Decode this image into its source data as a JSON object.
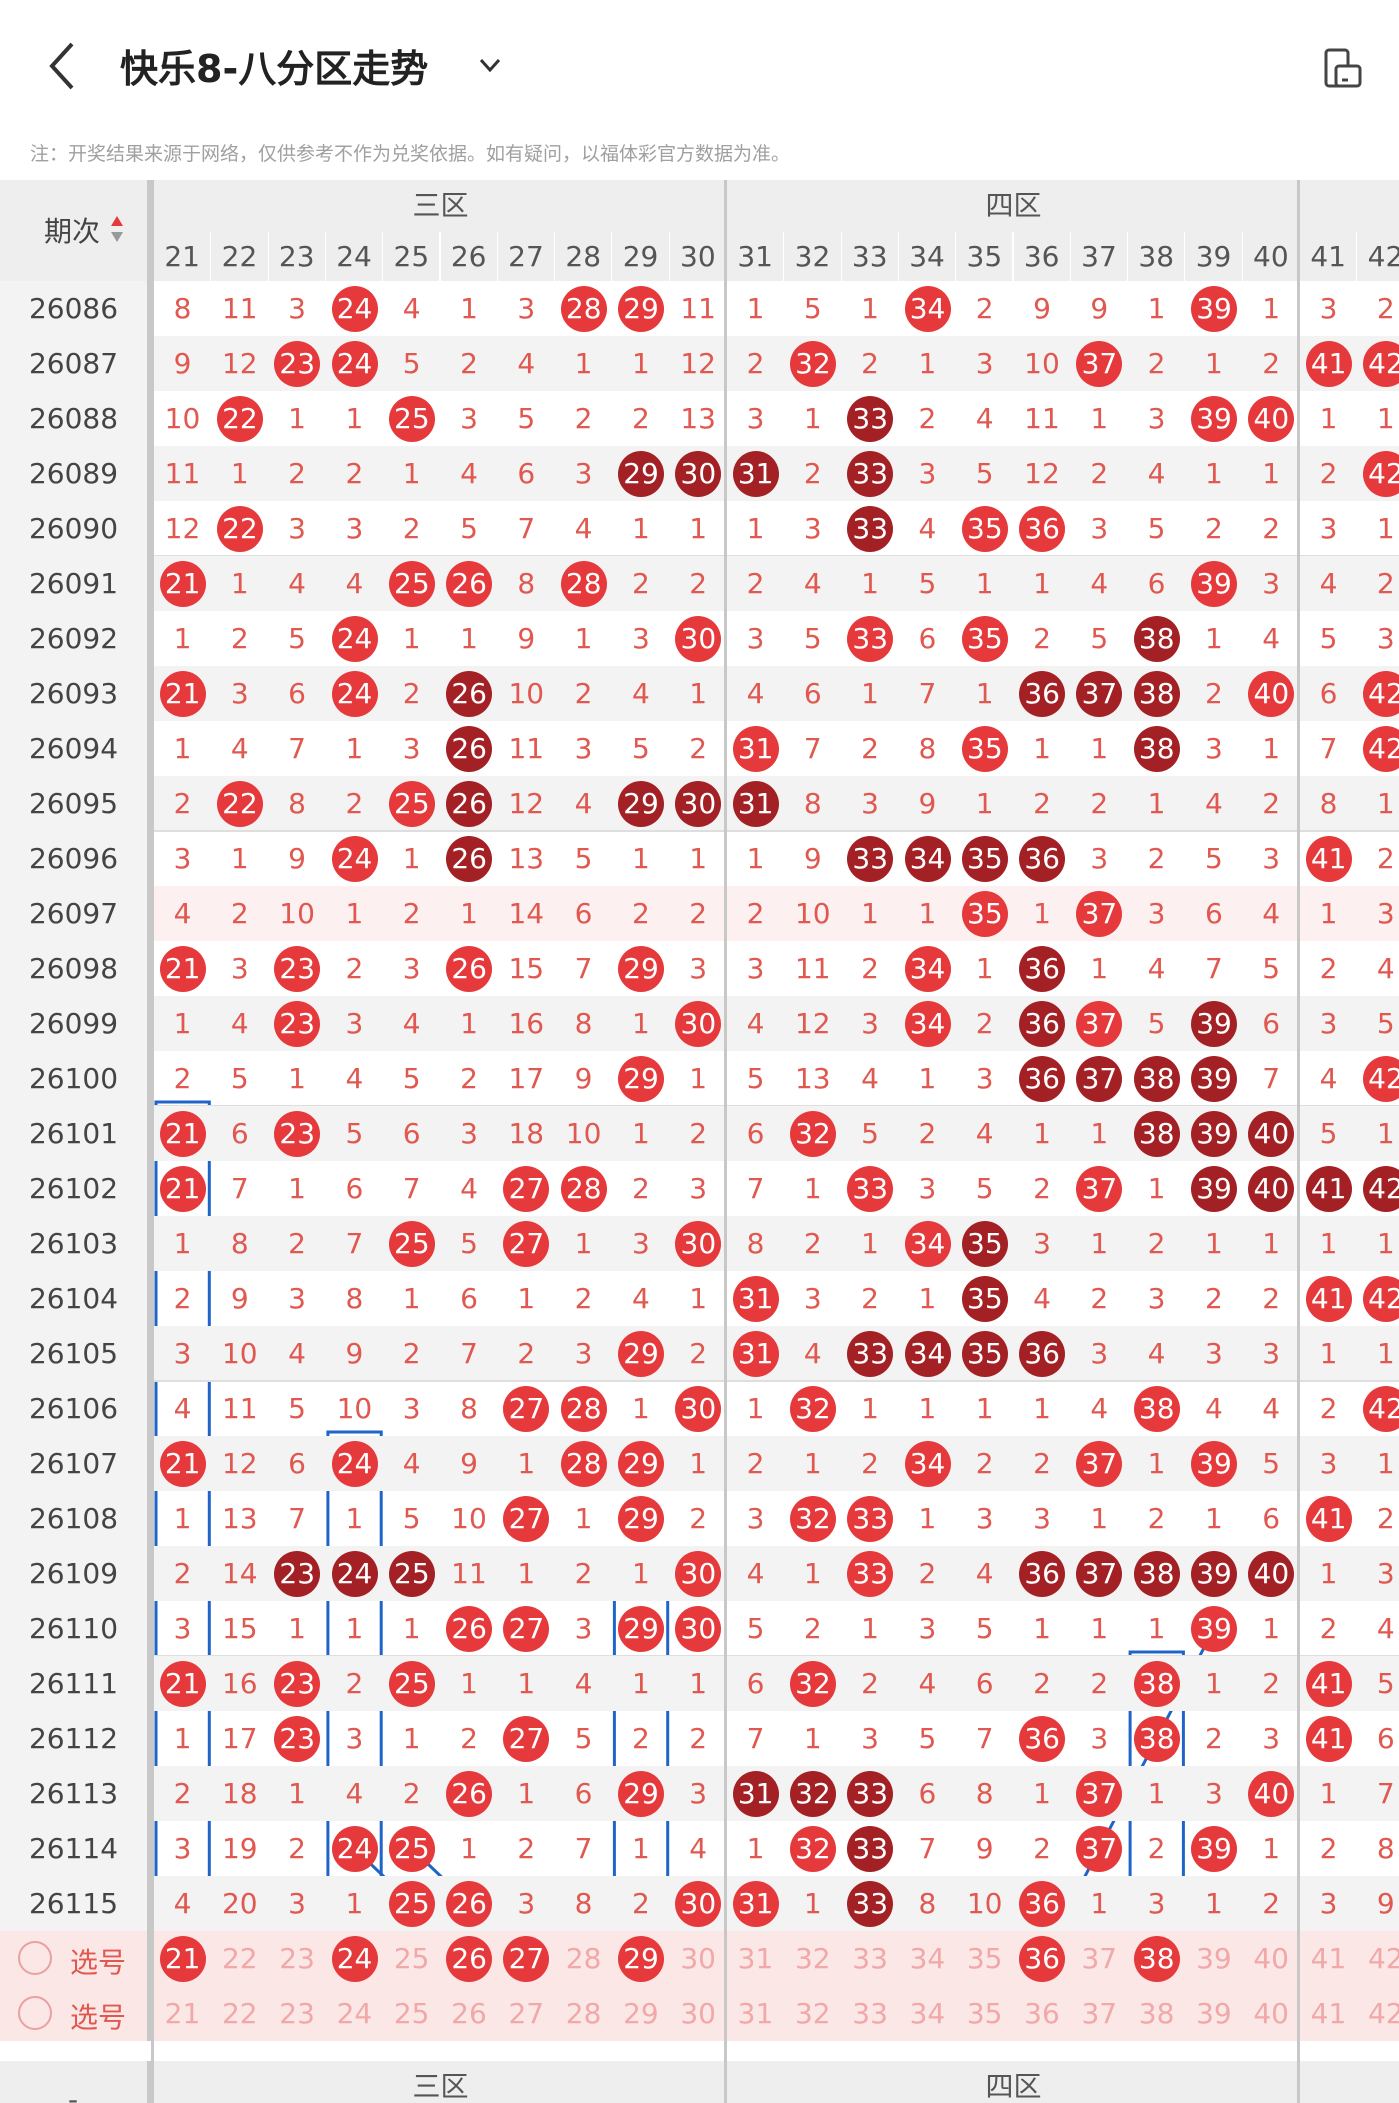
{
  "header": {
    "title": "快乐8-八分区走势"
  },
  "notice": "注：开奖结果来源于网络，仅供参考不作为兑奖依据。如有疑问，以福体彩官方数据为准。",
  "table": {
    "period_header": "期次",
    "zones": [
      {
        "name": "三区",
        "cols": [
          21,
          22,
          23,
          24,
          25,
          26,
          27,
          28,
          29,
          30
        ]
      },
      {
        "name": "四区",
        "cols": [
          31,
          32,
          33,
          34,
          35,
          36,
          37,
          38,
          39,
          40
        ]
      },
      {
        "name": "",
        "cols": [
          41,
          42
        ]
      }
    ],
    "rows": [
      {
        "period": "26086",
        "cells": [
          "8",
          "11",
          "3",
          "24",
          "4",
          "1",
          "3",
          "28",
          "29",
          "11",
          "1",
          "5",
          "1",
          "34",
          "2",
          "9",
          "9",
          "1",
          "39",
          "1",
          "3",
          "2"
        ],
        "dark": []
      },
      {
        "period": "26087",
        "cells": [
          "9",
          "12",
          "23",
          "24",
          "5",
          "2",
          "4",
          "1",
          "1",
          "12",
          "2",
          "32",
          "2",
          "1",
          "3",
          "10",
          "37",
          "2",
          "1",
          "2",
          "41",
          "42"
        ],
        "dark": []
      },
      {
        "period": "26088",
        "cells": [
          "10",
          "22",
          "1",
          "1",
          "25",
          "3",
          "5",
          "2",
          "2",
          "13",
          "3",
          "1",
          "33",
          "2",
          "4",
          "11",
          "1",
          "3",
          "39",
          "40",
          "1",
          "1"
        ],
        "dark": [
          "33"
        ]
      },
      {
        "period": "26089",
        "cells": [
          "11",
          "1",
          "2",
          "2",
          "1",
          "4",
          "6",
          "3",
          "29",
          "30",
          "31",
          "2",
          "33",
          "3",
          "5",
          "12",
          "2",
          "4",
          "1",
          "1",
          "2",
          "42"
        ],
        "dark": [
          "29",
          "30",
          "31",
          "33"
        ]
      },
      {
        "period": "26090",
        "cells": [
          "12",
          "22",
          "3",
          "3",
          "2",
          "5",
          "7",
          "4",
          "1",
          "1",
          "1",
          "3",
          "33",
          "4",
          "35",
          "36",
          "3",
          "5",
          "2",
          "2",
          "3",
          "1"
        ],
        "dark": [
          "33"
        ]
      },
      {
        "period": "26091",
        "cells": [
          "21",
          "1",
          "4",
          "4",
          "25",
          "26",
          "8",
          "28",
          "2",
          "2",
          "2",
          "4",
          "1",
          "5",
          "1",
          "1",
          "4",
          "6",
          "39",
          "3",
          "4",
          "2"
        ],
        "dark": []
      },
      {
        "period": "26092",
        "cells": [
          "1",
          "2",
          "5",
          "24",
          "1",
          "1",
          "9",
          "1",
          "3",
          "30",
          "3",
          "5",
          "33",
          "6",
          "35",
          "2",
          "5",
          "38",
          "1",
          "4",
          "5",
          "3"
        ],
        "dark": [
          "38"
        ]
      },
      {
        "period": "26093",
        "cells": [
          "21",
          "3",
          "6",
          "24",
          "2",
          "26",
          "10",
          "2",
          "4",
          "1",
          "4",
          "6",
          "1",
          "7",
          "1",
          "36",
          "37",
          "38",
          "2",
          "40",
          "6",
          "42"
        ],
        "dark": [
          "26",
          "36",
          "37",
          "38"
        ]
      },
      {
        "period": "26094",
        "cells": [
          "1",
          "4",
          "7",
          "1",
          "3",
          "26",
          "11",
          "3",
          "5",
          "2",
          "31",
          "7",
          "2",
          "8",
          "35",
          "1",
          "1",
          "38",
          "3",
          "1",
          "7",
          "42"
        ],
        "dark": [
          "26",
          "38"
        ]
      },
      {
        "period": "26095",
        "cells": [
          "2",
          "22",
          "8",
          "2",
          "25",
          "26",
          "12",
          "4",
          "29",
          "30",
          "31",
          "8",
          "3",
          "9",
          "1",
          "2",
          "2",
          "1",
          "4",
          "2",
          "8",
          "1"
        ],
        "dark": [
          "26",
          "29",
          "30",
          "31"
        ]
      },
      {
        "period": "26096",
        "cells": [
          "3",
          "1",
          "9",
          "24",
          "1",
          "26",
          "13",
          "5",
          "1",
          "1",
          "1",
          "9",
          "33",
          "34",
          "35",
          "36",
          "3",
          "2",
          "5",
          "3",
          "41",
          "2"
        ],
        "dark": [
          "26",
          "33",
          "34",
          "35",
          "36"
        ]
      },
      {
        "period": "26097",
        "cells": [
          "4",
          "2",
          "10",
          "1",
          "2",
          "1",
          "14",
          "6",
          "2",
          "2",
          "2",
          "10",
          "1",
          "1",
          "35",
          "1",
          "37",
          "3",
          "6",
          "4",
          "1",
          "3"
        ],
        "dark": []
      },
      {
        "period": "26098",
        "cells": [
          "21",
          "3",
          "23",
          "2",
          "3",
          "26",
          "15",
          "7",
          "29",
          "3",
          "3",
          "11",
          "2",
          "34",
          "1",
          "36",
          "1",
          "4",
          "7",
          "5",
          "2",
          "4"
        ],
        "dark": [
          "36"
        ]
      },
      {
        "period": "26099",
        "cells": [
          "1",
          "4",
          "23",
          "3",
          "4",
          "1",
          "16",
          "8",
          "1",
          "30",
          "4",
          "12",
          "3",
          "34",
          "2",
          "36",
          "37",
          "5",
          "39",
          "6",
          "3",
          "5"
        ],
        "dark": [
          "36",
          "39"
        ]
      },
      {
        "period": "26100",
        "cells": [
          "2",
          "5",
          "1",
          "4",
          "5",
          "2",
          "17",
          "9",
          "29",
          "1",
          "5",
          "13",
          "4",
          "1",
          "3",
          "36",
          "37",
          "38",
          "39",
          "7",
          "4",
          "42"
        ],
        "dark": [
          "36",
          "37",
          "38",
          "39"
        ]
      },
      {
        "period": "26101",
        "cells": [
          "21",
          "6",
          "23",
          "5",
          "6",
          "3",
          "18",
          "10",
          "1",
          "2",
          "6",
          "32",
          "5",
          "2",
          "4",
          "1",
          "1",
          "38",
          "39",
          "40",
          "5",
          "1"
        ],
        "dark": [
          "38",
          "39",
          "40"
        ]
      },
      {
        "period": "26102",
        "cells": [
          "21",
          "7",
          "1",
          "6",
          "7",
          "4",
          "27",
          "28",
          "2",
          "3",
          "7",
          "1",
          "33",
          "3",
          "5",
          "2",
          "37",
          "1",
          "39",
          "40",
          "41",
          "42"
        ],
        "dark": [
          "39",
          "40",
          "41",
          "42"
        ]
      },
      {
        "period": "26103",
        "cells": [
          "1",
          "8",
          "2",
          "7",
          "25",
          "5",
          "27",
          "1",
          "3",
          "30",
          "8",
          "2",
          "1",
          "34",
          "35",
          "3",
          "1",
          "2",
          "1",
          "1",
          "1",
          "1"
        ],
        "dark": [
          "35"
        ]
      },
      {
        "period": "26104",
        "cells": [
          "2",
          "9",
          "3",
          "8",
          "1",
          "6",
          "1",
          "2",
          "4",
          "1",
          "31",
          "3",
          "2",
          "1",
          "35",
          "4",
          "2",
          "3",
          "2",
          "2",
          "41",
          "42"
        ],
        "dark": [
          "35"
        ]
      },
      {
        "period": "26105",
        "cells": [
          "3",
          "10",
          "4",
          "9",
          "2",
          "7",
          "2",
          "3",
          "29",
          "2",
          "31",
          "4",
          "33",
          "34",
          "35",
          "36",
          "3",
          "4",
          "3",
          "3",
          "1",
          "1"
        ],
        "dark": [
          "33",
          "34",
          "35",
          "36"
        ]
      },
      {
        "period": "26106",
        "cells": [
          "4",
          "11",
          "5",
          "10",
          "3",
          "8",
          "27",
          "28",
          "1",
          "30",
          "1",
          "32",
          "1",
          "1",
          "1",
          "1",
          "4",
          "38",
          "4",
          "4",
          "2",
          "42"
        ],
        "dark": []
      },
      {
        "period": "26107",
        "cells": [
          "21",
          "12",
          "6",
          "24",
          "4",
          "9",
          "1",
          "28",
          "29",
          "1",
          "2",
          "1",
          "2",
          "34",
          "2",
          "2",
          "37",
          "1",
          "39",
          "5",
          "3",
          "1"
        ],
        "dark": []
      },
      {
        "period": "26108",
        "cells": [
          "1",
          "13",
          "7",
          "1",
          "5",
          "10",
          "27",
          "1",
          "29",
          "2",
          "3",
          "32",
          "33",
          "1",
          "3",
          "3",
          "1",
          "2",
          "1",
          "6",
          "41",
          "2"
        ],
        "dark": []
      },
      {
        "period": "26109",
        "cells": [
          "2",
          "14",
          "23",
          "24",
          "25",
          "11",
          "1",
          "2",
          "1",
          "30",
          "4",
          "1",
          "33",
          "2",
          "4",
          "36",
          "37",
          "38",
          "39",
          "40",
          "1",
          "3"
        ],
        "dark": [
          "23",
          "24",
          "25",
          "36",
          "37",
          "38",
          "39",
          "40"
        ]
      },
      {
        "period": "26110",
        "cells": [
          "3",
          "15",
          "1",
          "1",
          "1",
          "26",
          "27",
          "3",
          "29",
          "30",
          "5",
          "2",
          "1",
          "3",
          "5",
          "1",
          "1",
          "1",
          "39",
          "1",
          "2",
          "4"
        ],
        "dark": []
      },
      {
        "period": "26111",
        "cells": [
          "21",
          "16",
          "23",
          "2",
          "25",
          "1",
          "1",
          "4",
          "1",
          "1",
          "6",
          "32",
          "2",
          "4",
          "6",
          "2",
          "2",
          "38",
          "1",
          "2",
          "41",
          "5"
        ],
        "dark": []
      },
      {
        "period": "26112",
        "cells": [
          "1",
          "17",
          "23",
          "3",
          "1",
          "2",
          "27",
          "5",
          "2",
          "2",
          "7",
          "1",
          "3",
          "5",
          "7",
          "36",
          "3",
          "38",
          "2",
          "3",
          "41",
          "6"
        ],
        "dark": []
      },
      {
        "period": "26113",
        "cells": [
          "2",
          "18",
          "1",
          "4",
          "2",
          "26",
          "1",
          "6",
          "29",
          "3",
          "31",
          "32",
          "33",
          "6",
          "8",
          "1",
          "37",
          "1",
          "3",
          "40",
          "1",
          "7"
        ],
        "dark": [
          "31",
          "32",
          "33"
        ]
      },
      {
        "period": "26114",
        "cells": [
          "3",
          "19",
          "2",
          "24",
          "25",
          "1",
          "2",
          "7",
          "1",
          "4",
          "1",
          "32",
          "33",
          "7",
          "9",
          "2",
          "37",
          "2",
          "39",
          "1",
          "2",
          "8"
        ],
        "dark": [
          "33"
        ]
      },
      {
        "period": "26115",
        "cells": [
          "4",
          "20",
          "3",
          "1",
          "25",
          "26",
          "3",
          "8",
          "2",
          "30",
          "31",
          "1",
          "33",
          "8",
          "10",
          "36",
          "1",
          "3",
          "1",
          "2",
          "3",
          "9"
        ],
        "dark": [
          "33"
        ]
      }
    ],
    "pick_rows": [
      {
        "label": "选号",
        "cells": [
          "21",
          "22",
          "23",
          "24",
          "25",
          "26",
          "27",
          "28",
          "29",
          "30",
          "31",
          "32",
          "33",
          "34",
          "35",
          "36",
          "37",
          "38",
          "39",
          "40",
          "41",
          "42"
        ],
        "selected": [
          "21",
          "24",
          "26",
          "27",
          "29",
          "36",
          "38"
        ]
      },
      {
        "label": "选号",
        "cells": [
          "21",
          "22",
          "23",
          "24",
          "25",
          "26",
          "27",
          "28",
          "29",
          "30",
          "31",
          "32",
          "33",
          "34",
          "35",
          "36",
          "37",
          "38",
          "39",
          "40",
          "41",
          "42"
        ],
        "selected": []
      }
    ],
    "footer": {
      "dash": "-",
      "zones": [
        "三区",
        "四区"
      ]
    }
  },
  "colors": {
    "ball_red": "#e5393c",
    "ball_dark": "#a32125",
    "miss_text": "#e0584f",
    "annotation": "#1f64c8"
  }
}
